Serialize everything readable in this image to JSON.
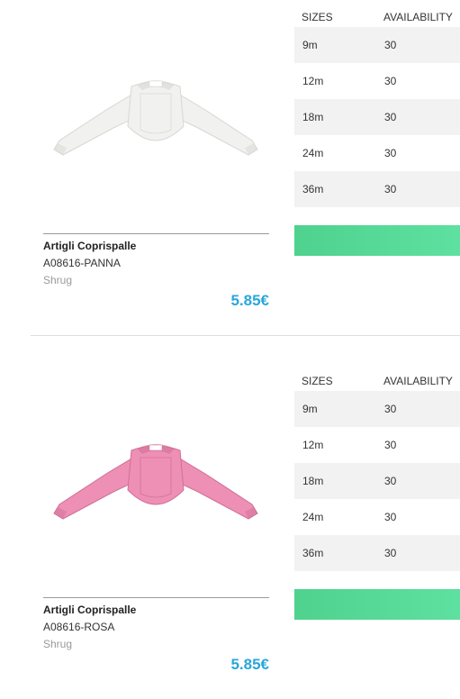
{
  "table_headers": {
    "size": "SIZES",
    "availability": "AVAILABILITY"
  },
  "products": [
    {
      "name": "Artigli Coprispalle",
      "code": "A08616-PANNA",
      "category": "Shrug",
      "price": "5.85€",
      "image_color": "#f1f1ef",
      "image_shade": "#d7d7d4",
      "sizes": [
        {
          "size": "9m",
          "availability": "30"
        },
        {
          "size": "12m",
          "availability": "30"
        },
        {
          "size": "18m",
          "availability": "30"
        },
        {
          "size": "24m",
          "availability": "30"
        },
        {
          "size": "36m",
          "availability": "30"
        }
      ]
    },
    {
      "name": "Artigli Coprispalle",
      "code": "A08616-ROSA",
      "category": "Shrug",
      "price": "5.85€",
      "image_color": "#ee8fb5",
      "image_shade": "#d06f96",
      "sizes": [
        {
          "size": "9m",
          "availability": "30"
        },
        {
          "size": "12m",
          "availability": "30"
        },
        {
          "size": "18m",
          "availability": "30"
        },
        {
          "size": "24m",
          "availability": "30"
        },
        {
          "size": "36m",
          "availability": "30"
        }
      ]
    }
  ],
  "colors": {
    "price": "#2aa6dc",
    "add_button": "#5ee0a0",
    "row_alt": "#f2f2f2"
  }
}
